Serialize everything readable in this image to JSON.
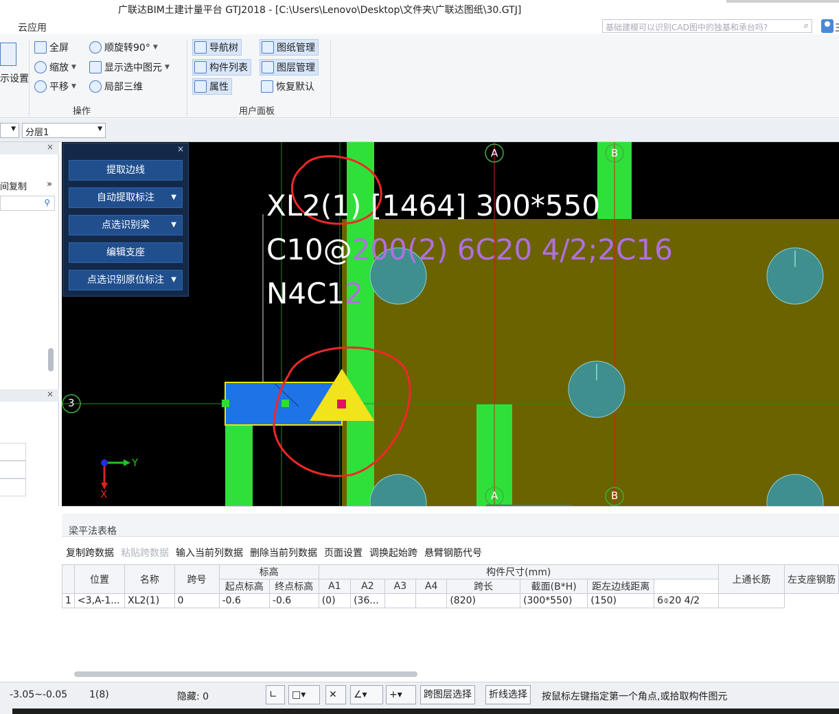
{
  "window": {
    "title": "广联达BIM土建计量平台 GTJ2018 - [C:\\Users\\Lenovo\\Desktop\\文件夹\\广联达图纸\\30.GTJ]"
  },
  "menu": {
    "tab_cloud": "云应用",
    "search_placeholder": "基础建模可以识别CAD图中的独基和承台吗?",
    "user_partial": "王"
  },
  "ribbon": {
    "left_partial": "示设置",
    "operation": {
      "fullscreen": "全屏",
      "zoom": "缩放",
      "pan": "平移",
      "rotate": "顺旋转90°",
      "show_selected": "显示选中图元",
      "local_3d": "局部三维",
      "group_label": "操作"
    },
    "user_panel": {
      "nav_tree": "导航树",
      "component_list": "构件列表",
      "properties": "属性",
      "drawing_mgmt": "图纸管理",
      "layer_mgmt": "图层管理",
      "restore_default": "恢复默认",
      "group_label": "用户面板"
    }
  },
  "toolbar2": {
    "layer": "分层1"
  },
  "left_panel": {
    "copy_label": "间复制"
  },
  "float_panel": {
    "buttons": [
      "提取边线",
      "自动提取标注",
      "点选识别梁",
      "编辑支座",
      "点选识别原位标注"
    ]
  },
  "cad": {
    "beam_line1": "XL2(1) [1464] 300*550",
    "beam_line2_white": "C10@",
    "beam_line2_purple": "200(2) 6C20 4/2;2C16",
    "beam_line3_white": "N4C1",
    "beam_line3_purple": "2",
    "axis_A": "A",
    "axis_B": "B",
    "axis_3": "3",
    "ucs_y": "Y",
    "ucs_x": "X"
  },
  "table_panel": {
    "title": "梁平法表格",
    "actions": [
      "复制跨数据",
      "粘贴跨数据",
      "输入当前列数据",
      "删除当前列数据",
      "页面设置",
      "调换起始跨",
      "悬臂钢筋代号"
    ],
    "disabled_actions": [
      "粘贴跨数据"
    ],
    "headers": {
      "position": "位置",
      "name": "名称",
      "span_no": "跨号",
      "elevation": "标高",
      "start_elev": "起点标高",
      "end_elev": "终点标高",
      "size": "构件尺寸(mm)",
      "a1": "A1",
      "a2": "A2",
      "a3": "A3",
      "a4": "A4",
      "span_len": "跨长",
      "section": "截面(B*H)",
      "edge_dist": "距左边线距离",
      "top_rebar": "上通长筋",
      "left_rebar": "左支座钢筋"
    },
    "row": {
      "index": "1",
      "position": "<3,A-1...",
      "name": "XL2(1)",
      "span_no": "0",
      "start_elev": "-0.6",
      "end_elev": "-0.6",
      "a1": "(0)",
      "a2": "(36...",
      "a3": "",
      "a4": "",
      "span_len": "(820)",
      "section": "(300*550)",
      "edge_dist": "(150)",
      "top_rebar": "6⌽20 4/2",
      "left_rebar": ""
    }
  },
  "status": {
    "elev_range": "-3.05~-0.05",
    "count": "1(8)",
    "hidden": "隐藏: 0",
    "cross_layer": "跨图层选择",
    "polyline": "折线选择",
    "hint": "按鼠标左键指定第一个角点,或拾取构件图元"
  },
  "colors": {
    "cad_background": "#000000",
    "column_green": "#2fe03a",
    "slab_olive": "#6b6200",
    "beam_blue": "#1e73e6",
    "pile_teal": "#3e8f8e",
    "annotation_red": "#f02828",
    "label_purple": "#b070e0",
    "label_white": "#ffffff"
  }
}
